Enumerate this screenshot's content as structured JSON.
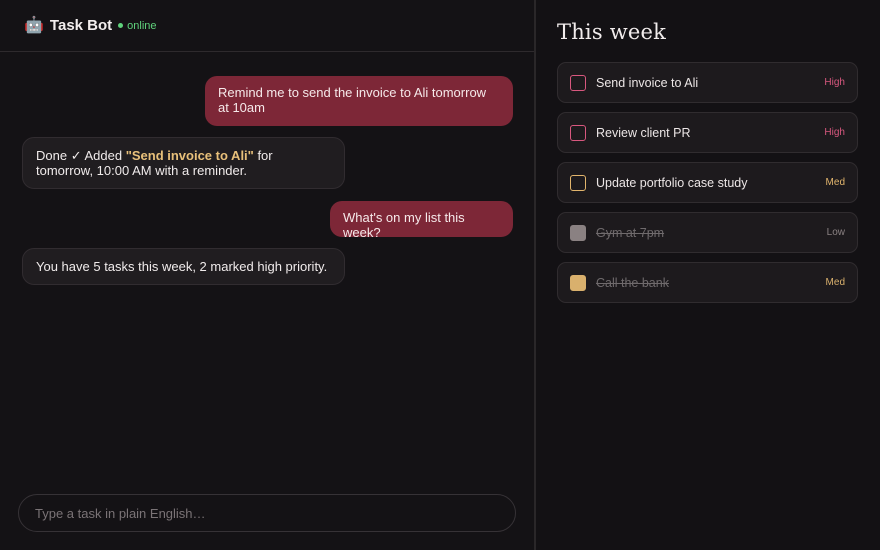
{
  "header": {
    "emoji": "🤖",
    "name": "Task Bot",
    "status": "online"
  },
  "messages": [
    {
      "role": "user",
      "text": "Remind me to send the invoice to Ali tomorrow at 10am"
    },
    {
      "role": "bot",
      "text_before": "Done ✓ Added ",
      "highlight": "\"Send invoice to Ali\"",
      "text_after": " for tomorrow, 10:00 AM with a reminder."
    },
    {
      "role": "user",
      "text": "What's on my list this week?"
    },
    {
      "role": "bot",
      "text": "You have 5 tasks this week, 2 marked high priority."
    }
  ],
  "composer": {
    "placeholder": "Type a task in plain English…"
  },
  "panel": {
    "title": "This week",
    "tasks": [
      {
        "label": "Send invoice to Ali",
        "priority": "High",
        "done": false,
        "color": "#d8587f"
      },
      {
        "label": "Review client PR",
        "priority": "High",
        "done": false,
        "color": "#d8587f"
      },
      {
        "label": "Update portfolio case study",
        "priority": "Med",
        "done": false,
        "color": "#e2b56d"
      },
      {
        "label": "Gym at 7pm",
        "priority": "Low",
        "done": true,
        "color": "#8a8182"
      },
      {
        "label": "Call the bank",
        "priority": "Med",
        "done": true,
        "color": "#d9b06d"
      }
    ]
  },
  "colors": {
    "accent_user_bubble": "#7d2737",
    "highlight": "#e8c07a",
    "online": "#5fd27c",
    "priority_high": "#d8587f",
    "priority_med": "#e2b56d",
    "priority_low": "#8a8182"
  }
}
